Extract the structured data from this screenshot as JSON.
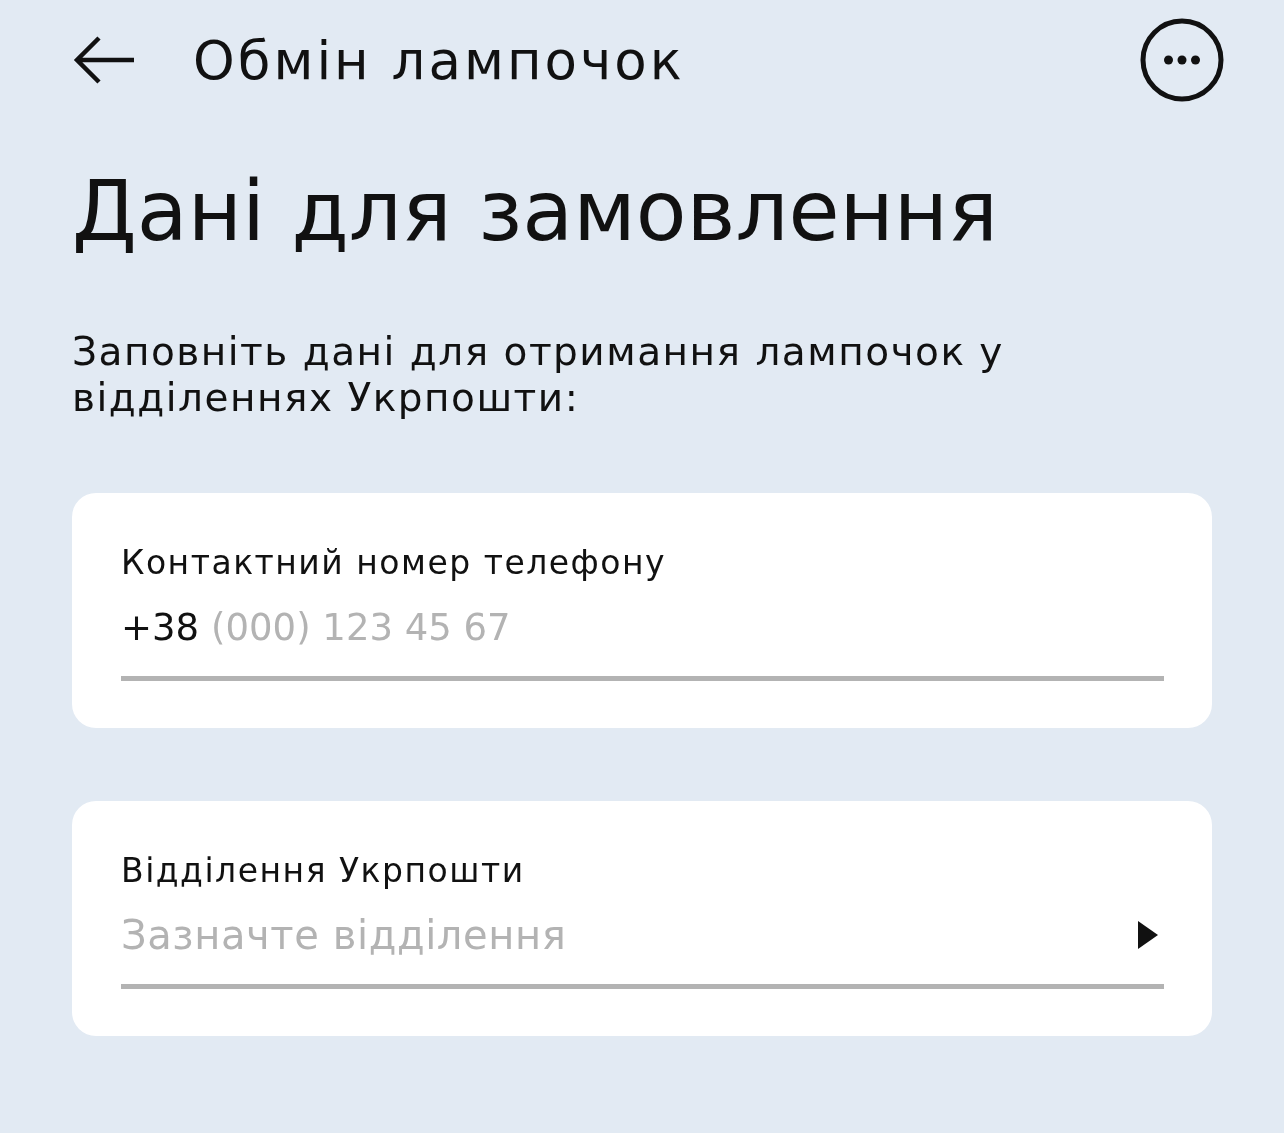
{
  "header": {
    "title": "Обмін лампочок"
  },
  "page": {
    "heading": "Дані для замовлення",
    "description": "Заповніть дані для отримання лампочок у відділеннях Укрпошти:"
  },
  "fields": [
    {
      "kind": "phone",
      "label": "Контактний номер телефону",
      "prefix": "+38",
      "placeholder": "(000) 123 45 67"
    },
    {
      "kind": "select",
      "label": "Відділення Укрпошти",
      "placeholder": "Зазначте відділення"
    }
  ]
}
